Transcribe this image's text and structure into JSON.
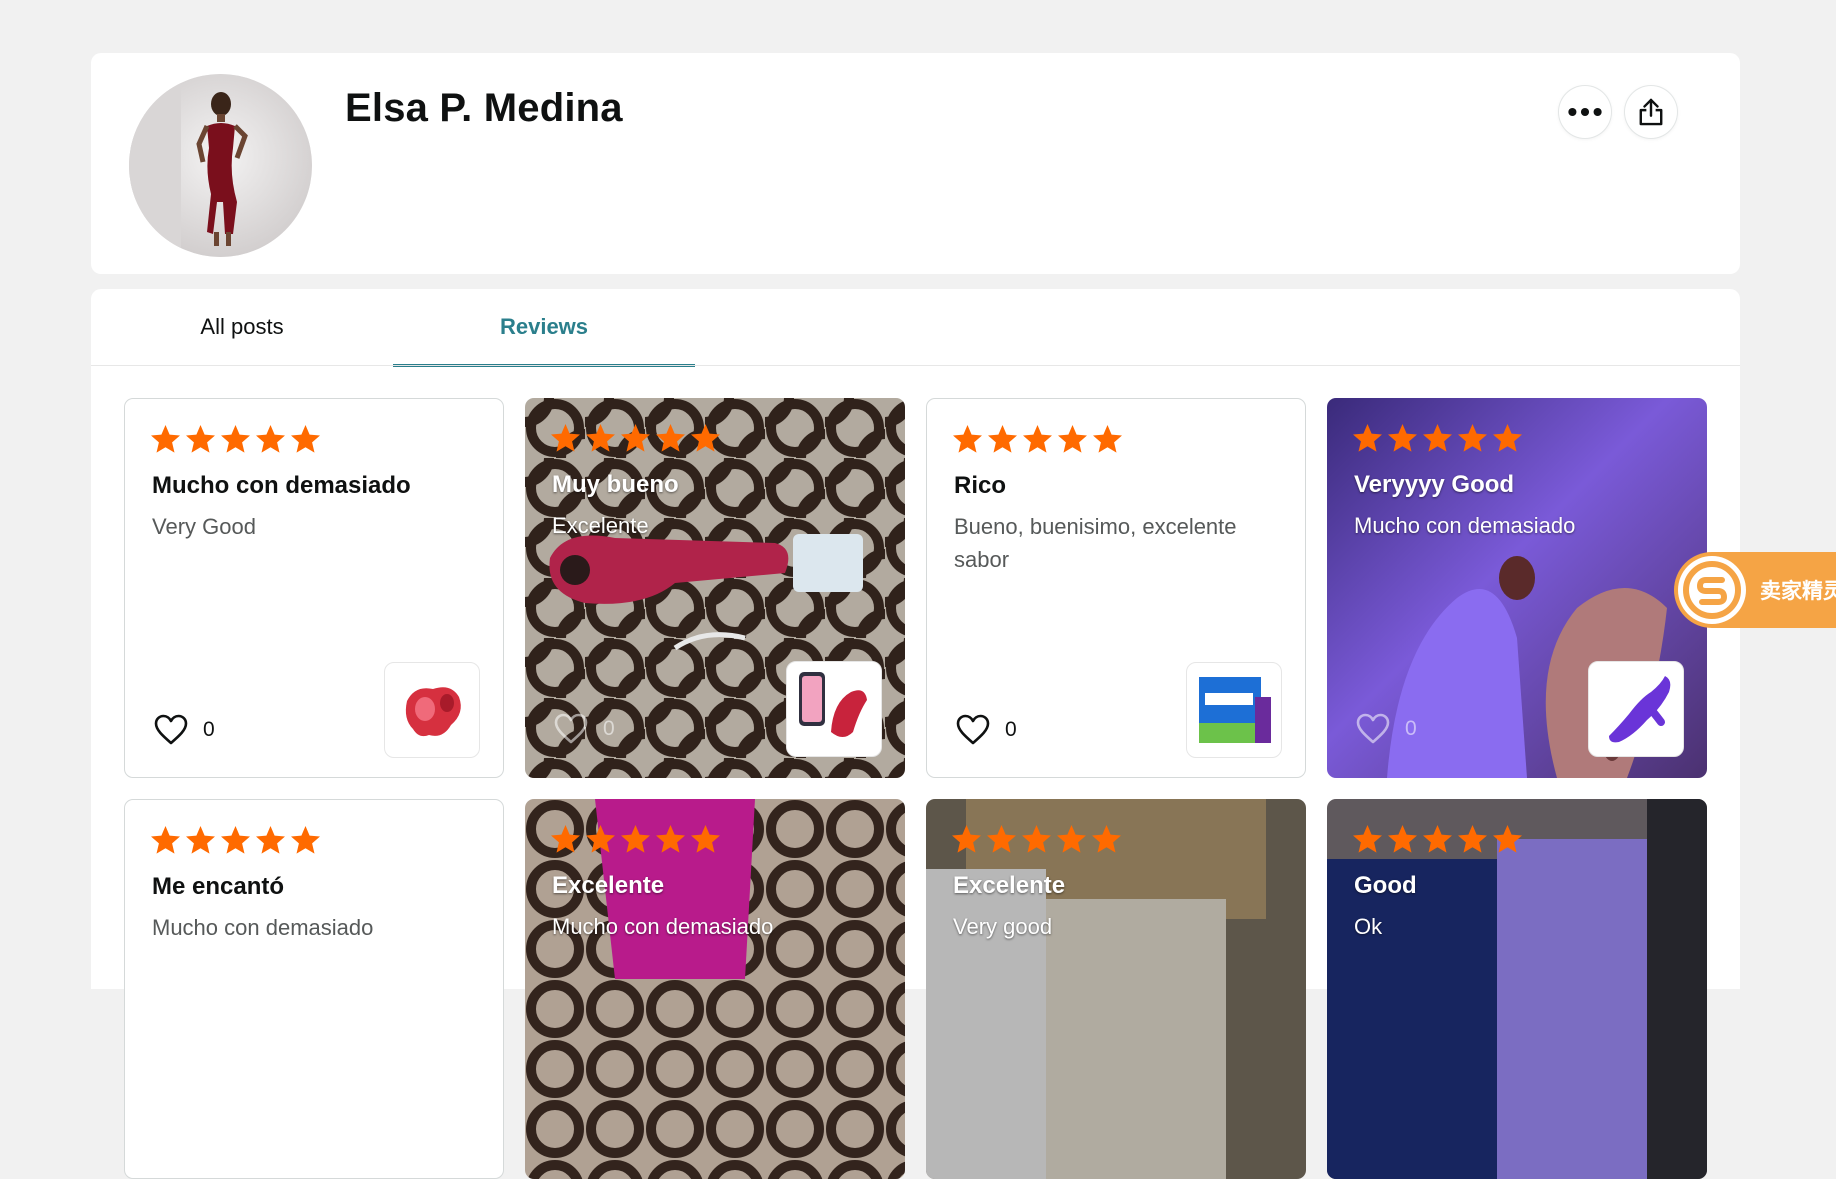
{
  "profile": {
    "name": "Elsa P. Medina",
    "more_icon": "more-dots-icon",
    "share_icon": "share-icon"
  },
  "tabs": [
    {
      "label": "All posts",
      "active": false
    },
    {
      "label": "Reviews",
      "active": true
    }
  ],
  "colors": {
    "accent": "#2b7f8c",
    "star": "#ff6a00",
    "extension": "#f5a445"
  },
  "reviews": [
    {
      "rating": 5,
      "title": "Mucho con demasiado",
      "body": "Very Good",
      "likes": "0",
      "has_media": false
    },
    {
      "rating": 5,
      "title": "Muy bueno",
      "body": "Excelente",
      "likes": "0",
      "has_media": true
    },
    {
      "rating": 5,
      "title": "Rico",
      "body": "Bueno, buenisimo, excelente sabor",
      "likes": "0",
      "has_media": false
    },
    {
      "rating": 5,
      "title": "Veryyyy Good",
      "body": "Mucho con demasiado",
      "likes": "0",
      "has_media": true
    },
    {
      "rating": 5,
      "title": "Me encantó",
      "body": "Mucho con demasiado",
      "likes": "",
      "has_media": false
    },
    {
      "rating": 5,
      "title": "Excelente",
      "body": "Mucho con demasiado",
      "likes": "",
      "has_media": true
    },
    {
      "rating": 5,
      "title": "Excelente",
      "body": "Very good",
      "likes": "",
      "has_media": true
    },
    {
      "rating": 5,
      "title": "Good",
      "body": "Ok",
      "likes": "",
      "has_media": true
    }
  ],
  "extension_badge": {
    "text": "卖家精灵",
    "icon": "seller-sprite-logo-icon"
  }
}
